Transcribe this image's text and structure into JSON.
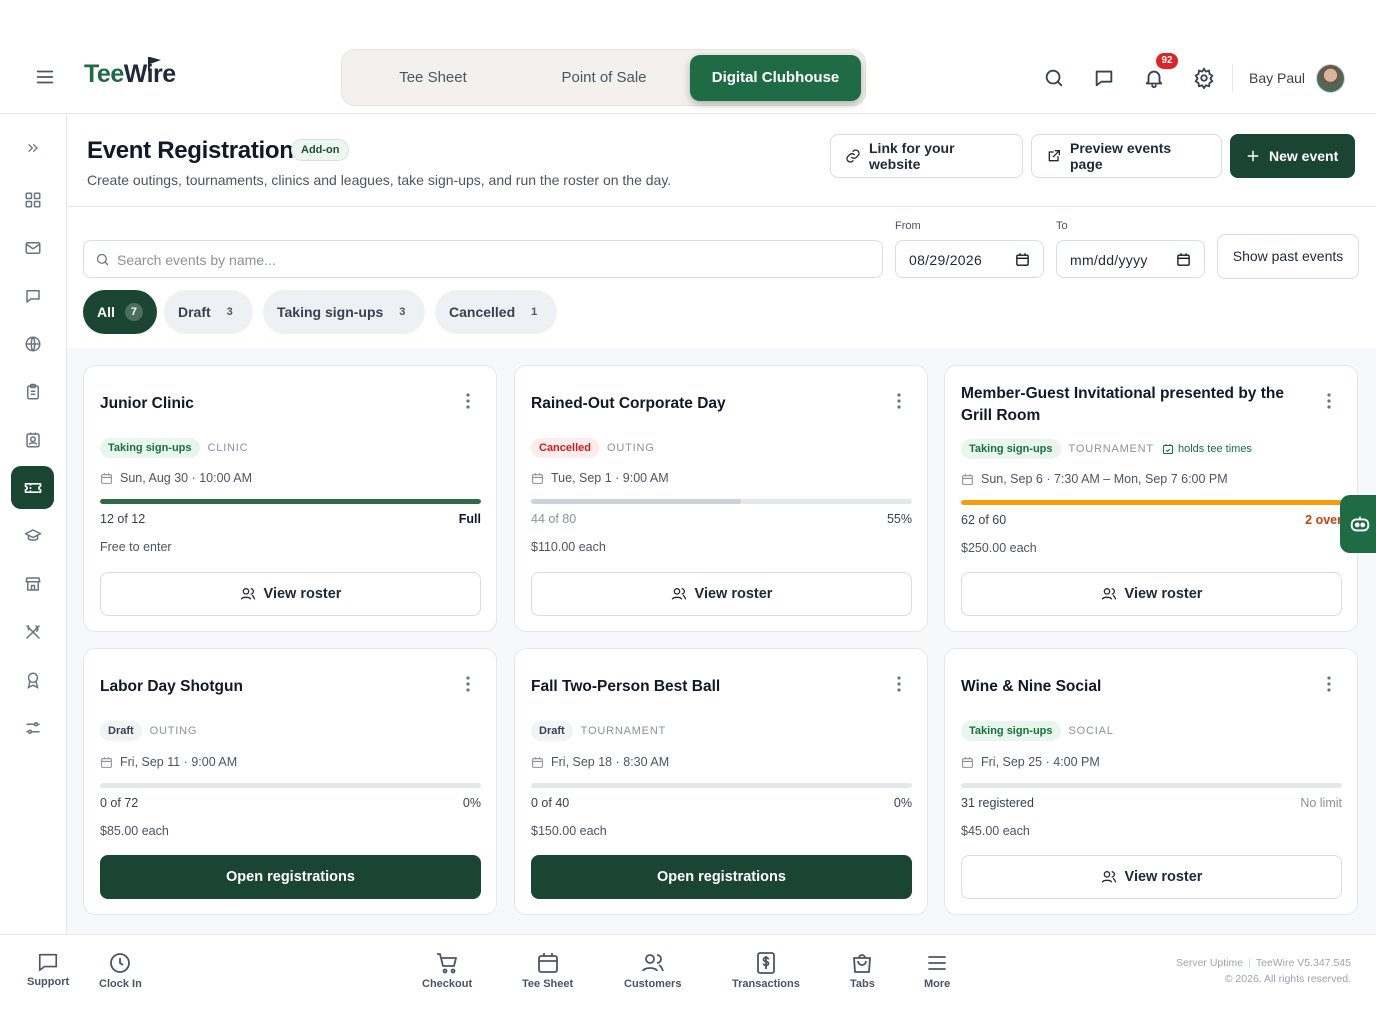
{
  "header": {
    "logo_tee": "Tee",
    "logo_wire": "Wire",
    "nav": [
      "Tee Sheet",
      "Point of Sale",
      "Digital Clubhouse"
    ],
    "notifications_count": "92",
    "user_name": "Bay Paul"
  },
  "page": {
    "title": "Event Registration",
    "addon_badge": "Add-on",
    "subtitle": "Create outings, tournaments, clinics and leagues, take sign-ups, and run the roster on the day.",
    "link_button": "Link for your website",
    "preview_button": "Preview events page",
    "new_button": "New event"
  },
  "filters": {
    "search_placeholder": "Search events by name...",
    "from_label": "From",
    "from_value": "08/29/2026",
    "to_label": "To",
    "to_value": "mm/dd/yyyy",
    "past_button": "Show past events",
    "chips": [
      {
        "label": "All",
        "count": "7"
      },
      {
        "label": "Draft",
        "count": "3"
      },
      {
        "label": "Taking sign-ups",
        "count": "3"
      },
      {
        "label": "Cancelled",
        "count": "1"
      }
    ]
  },
  "events": [
    {
      "title": "Junior Clinic",
      "status": "Taking sign-ups",
      "status_color": "#17703f",
      "type": "CLINIC",
      "when": "Sun, Aug 30 · 10:00 AM",
      "progress": 1.0,
      "bar_color": "#2f6a4c",
      "cap_left": "12 of 12",
      "cap_right": "Full",
      "price": "Free to enter",
      "button": "View roster"
    },
    {
      "title": "Rained-Out Corporate Day",
      "status": "Cancelled",
      "status_color": "#c81e1e",
      "type": "OUTING",
      "when": "Tue, Sep 1 · 9:00 AM",
      "progress": 0.55,
      "bar_color": "#cbd2da",
      "cap_left": "44 of 80",
      "cap_right": "55%",
      "price": "$110.00 each",
      "button": "View roster"
    },
    {
      "title": "Member-Guest Invitational presented by the Grill Room",
      "status": "Taking sign-ups",
      "status_color": "#17703f",
      "type": "TOURNAMENT",
      "extra_tag": "holds tee times",
      "when": "Sun, Sep 6 · 7:30 AM – Mon, Sep 7 6:00 PM",
      "progress": 1.0,
      "bar_color": "#f59e0b",
      "cap_left": "62 of 60",
      "cap_right": "2 over",
      "price": "$250.00 each",
      "button": "View roster"
    },
    {
      "title": "Labor Day Shotgun",
      "status": "Draft",
      "status_color": "#374151",
      "type": "OUTING",
      "when": "Fri, Sep 11 · 9:00 AM",
      "progress": 0,
      "bar_color": "#e5e7eb",
      "cap_left": "0 of 72",
      "cap_right": "0%",
      "price": "$85.00 each",
      "button": "Open registrations"
    },
    {
      "title": "Fall Two-Person Best Ball",
      "status": "Draft",
      "status_color": "#374151",
      "type": "TOURNAMENT",
      "when": "Fri, Sep 18 · 8:30 AM",
      "progress": 0,
      "bar_color": "#e5e7eb",
      "cap_left": "0 of 40",
      "cap_right": "0%",
      "price": "$150.00 each",
      "button": "Open registrations"
    },
    {
      "title": "Wine & Nine Social",
      "status": "Taking sign-ups",
      "status_color": "#17703f",
      "type": "SOCIAL",
      "when": "Fri, Sep 25 · 4:00 PM",
      "progress": 0,
      "bar_color": "#e5e7eb",
      "cap_left": "31 registered",
      "cap_right": "No limit",
      "price": "$45.00 each",
      "button": "View roster"
    }
  ],
  "footer": {
    "items": [
      "Support",
      "Clock In",
      "Checkout",
      "Tee Sheet",
      "Customers",
      "Transactions",
      "Tabs",
      "More"
    ],
    "server_uptime": "Server Uptime",
    "version": "TeeWire V5.347.545",
    "copyright": "© 2026. All rights reserved."
  },
  "colors": {
    "brand": "#1f6b45",
    "brand_dark": "#1b4533",
    "warning": "#f59e0b",
    "danger": "#dc2626"
  }
}
